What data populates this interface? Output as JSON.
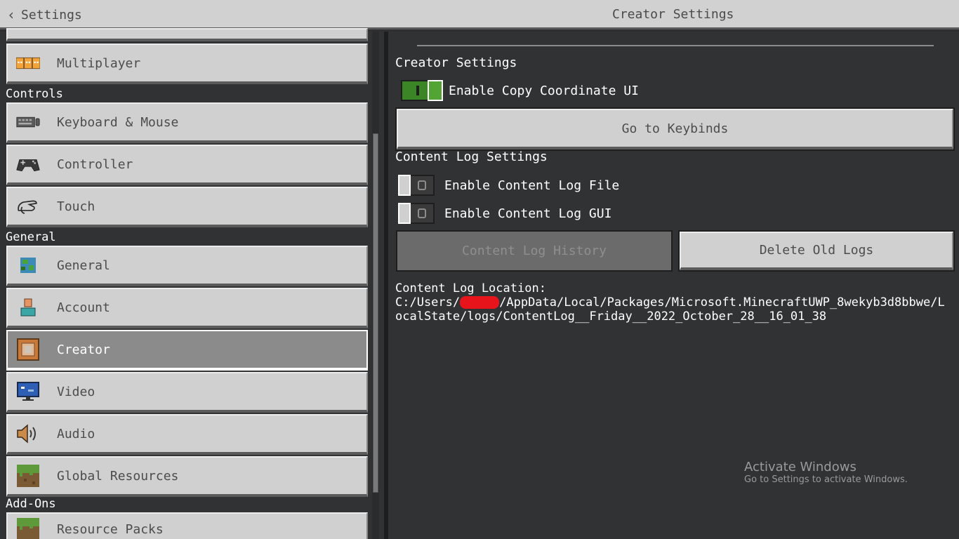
{
  "header": {
    "back_label": "Settings",
    "title": "Creator Settings"
  },
  "sidebar": {
    "sections": {
      "controls": "Controls",
      "general": "General",
      "addons": "Add-Ons"
    },
    "items": [
      {
        "label": "Multiplayer",
        "icon": "multiplayer-icon"
      },
      {
        "label": "Keyboard & Mouse",
        "icon": "keyboard-icon"
      },
      {
        "label": "Controller",
        "icon": "controller-icon"
      },
      {
        "label": "Touch",
        "icon": "touch-icon"
      },
      {
        "label": "General",
        "icon": "globe-icon"
      },
      {
        "label": "Account",
        "icon": "account-icon"
      },
      {
        "label": "Creator",
        "icon": "creator-icon",
        "selected": true
      },
      {
        "label": "Video",
        "icon": "monitor-icon"
      },
      {
        "label": "Audio",
        "icon": "speaker-icon"
      },
      {
        "label": "Global Resources",
        "icon": "grass-block-icon"
      },
      {
        "label": "Resource Packs",
        "icon": "grass-block-icon"
      }
    ]
  },
  "creator": {
    "heading": "Creator Settings",
    "copy_coord_label": "Enable Copy Coordinate UI",
    "copy_coord_on": true,
    "keybinds_button": "Go to Keybinds"
  },
  "content_log": {
    "heading": "Content Log Settings",
    "file_label": "Enable Content Log File",
    "file_on": false,
    "gui_label": "Enable Content Log GUI",
    "gui_on": false,
    "history_button": "Content Log History",
    "delete_button": "Delete Old Logs",
    "location_label": "Content Log Location:",
    "path_prefix": "C:/Users/",
    "path_suffix": "/AppData/Local/Packages/Microsoft.MinecraftUWP_8wekyb3d8bbwe/LocalState/logs/ContentLog__Friday__2022_October_28__16_01_38"
  },
  "watermark": {
    "title": "Activate Windows",
    "subtitle": "Go to Settings to activate Windows."
  },
  "colors": {
    "toggle_on": "#3c8527",
    "selected_item": "#8b8b8b",
    "button_bg": "#d0d0d0",
    "background": "#313233"
  }
}
